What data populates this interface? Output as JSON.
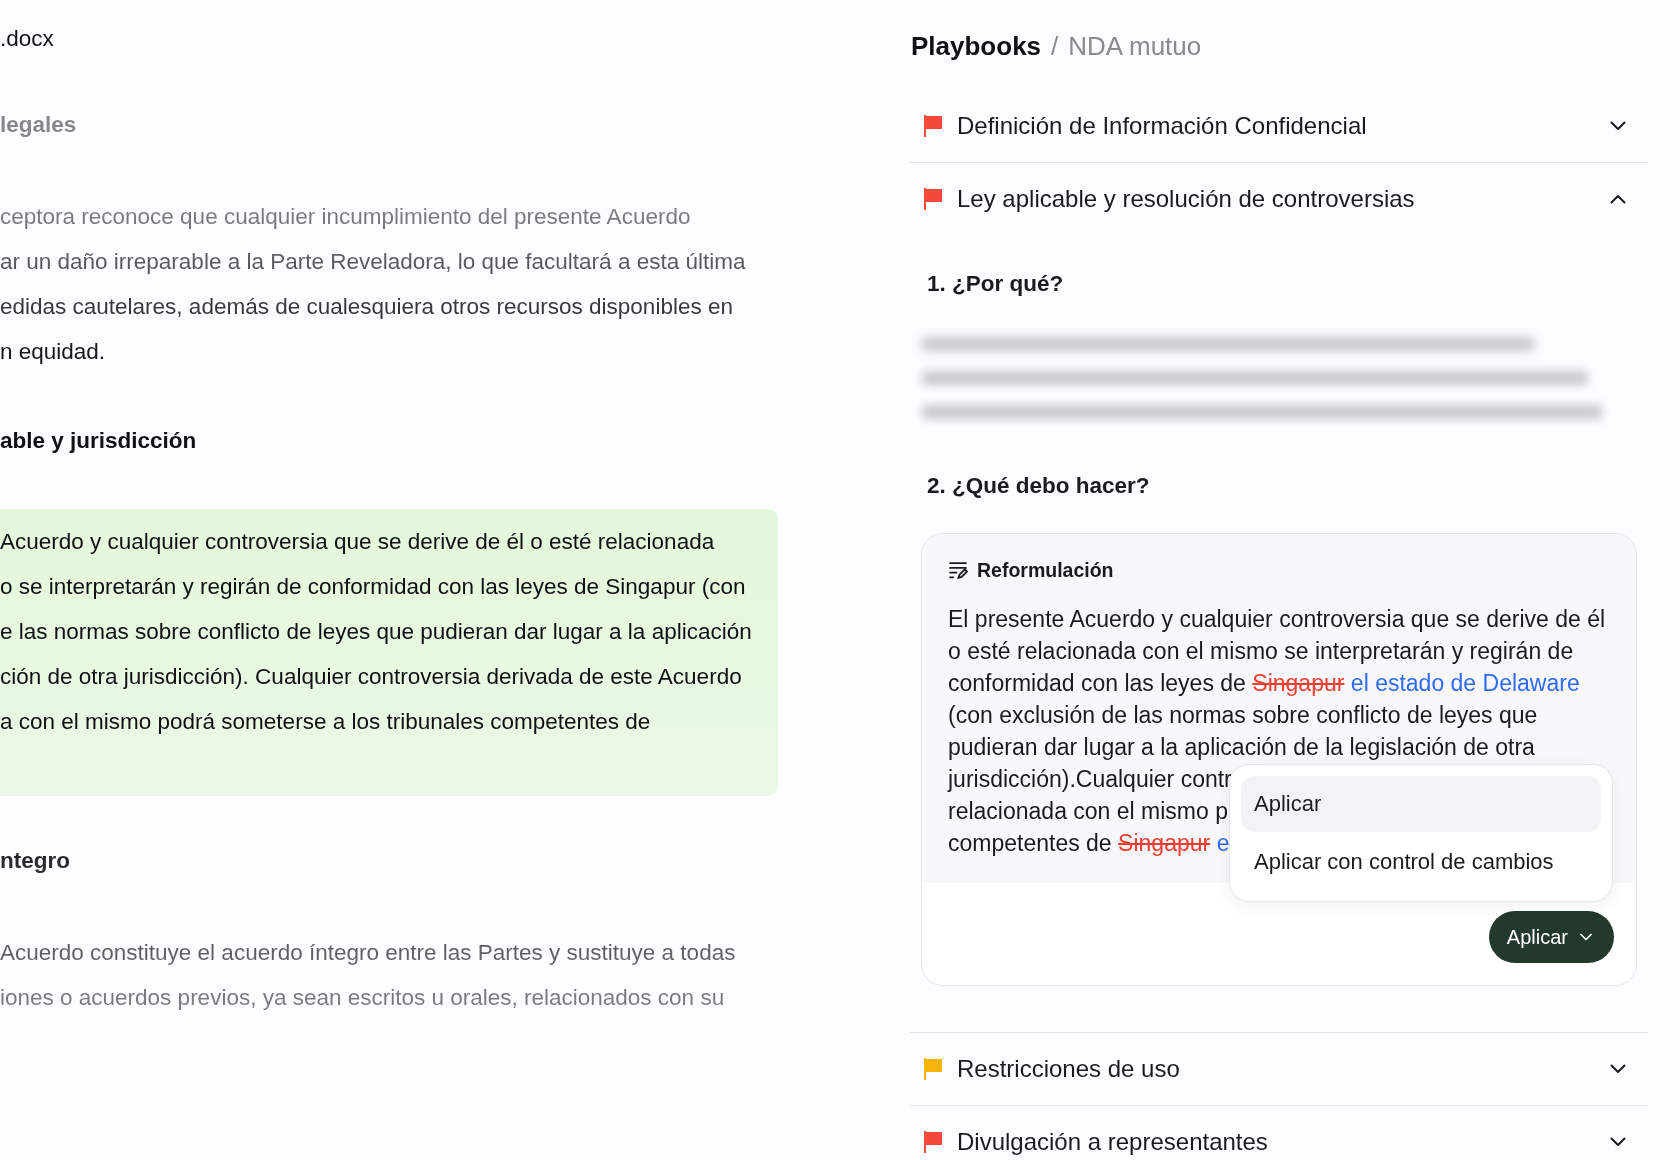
{
  "document": {
    "filename": ".docx",
    "blocks": [
      {
        "kind": "heading",
        "text": "legales"
      },
      {
        "kind": "paragraph",
        "highlighted": false,
        "lines": [
          "ceptora reconoce que cualquier incumplimiento del presente Acuerdo",
          "ar un daño irreparable a la Parte Reveladora, lo que facultará a esta última",
          "edidas cautelares, además de cualesquiera otros recursos disponibles en",
          "n equidad."
        ]
      },
      {
        "kind": "heading",
        "text": "able y jurisdicción"
      },
      {
        "kind": "paragraph",
        "highlighted": true,
        "lines": [
          "Acuerdo y cualquier controversia que se derive de él o esté relacionada",
          "o se interpretarán y regirán de conformidad con las leyes de Singapur (con",
          "e las normas sobre conflicto de leyes que pudieran dar lugar a la aplicación",
          "ción de otra jurisdicción). Cualquier controversia derivada de este Acuerdo",
          "a con el mismo podrá someterse a los tribunales competentes de"
        ]
      },
      {
        "kind": "heading",
        "text": "ntegro"
      },
      {
        "kind": "paragraph",
        "highlighted": false,
        "lines": [
          "Acuerdo constituye el acuerdo íntegro entre las Partes y sustituye a todas",
          "iones o acuerdos previos, ya sean escritos u orales, relacionados con su"
        ]
      }
    ]
  },
  "playbook": {
    "breadcrumb": {
      "root": "Playbooks",
      "separator": "/",
      "current": "NDA mutuo"
    },
    "clauses": [
      {
        "title": "Definición de Información Confidencial",
        "color": "#f2493b",
        "expanded": false
      },
      {
        "title": "Ley aplicable y resolución de controversias",
        "color": "#f2493b",
        "expanded": true,
        "why": {
          "heading": "1. ¿Por qué?"
        },
        "todo": {
          "heading": "2. ¿Qué debo hacer?",
          "card": {
            "label": "Reformulación",
            "lines": [
              [
                {
                  "kind": "text",
                  "text": "El presente Acuerdo y cualquier controversia que se derive de él"
                }
              ],
              [
                {
                  "kind": "text",
                  "text": "o esté relacionada con el mismo se interpretarán y regirán de"
                }
              ],
              [
                {
                  "kind": "text",
                  "text": "conformidad con las leyes de"
                },
                {
                  "kind": "deleted",
                  "text": "Singapur"
                },
                {
                  "kind": "inserted",
                  "text": "el estado de Delaware"
                }
              ],
              [
                {
                  "kind": "text",
                  "text": "(con exclusión de las normas sobre conflicto de leyes que"
                }
              ],
              [
                {
                  "kind": "text",
                  "text": "pudieran dar lugar a la aplicación de la legislación de otra"
                }
              ],
              [
                {
                  "kind": "text",
                  "text": "jurisdicción).Cualquier contr"
                }
              ],
              [
                {
                  "kind": "text",
                  "text": "relacionada con el mismo p"
                }
              ],
              [
                {
                  "kind": "text",
                  "text": "competentes de"
                },
                {
                  "kind": "deleted",
                  "text": "Singapur"
                },
                {
                  "kind": "inserted",
                  "text": "e"
                }
              ]
            ],
            "menu": {
              "items": [
                {
                  "label": "Aplicar",
                  "selected": true
                },
                {
                  "label": "Aplicar con control de cambios",
                  "selected": false
                }
              ]
            },
            "apply_button": "Aplicar"
          }
        }
      },
      {
        "title": "Restricciones de uso",
        "color": "#f5b40c",
        "expanded": false
      },
      {
        "title": "Divulgación a representantes",
        "color": "#f2493b",
        "expanded": false
      }
    ]
  }
}
